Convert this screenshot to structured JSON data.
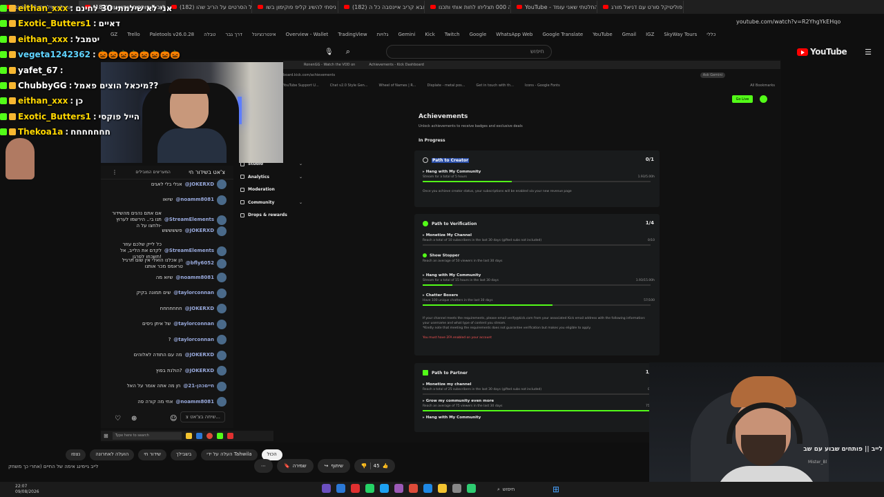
{
  "browser": {
    "tabs": [
      {
        "label": "אני לא שילמתי 30 לחינם",
        "active": false
      },
      {
        "label": "(182) לייב || פותחים שבוע עם",
        "active": true
      },
      {
        "label": "(182) כל הסרטים על הריב שהו",
        "active": false
      },
      {
        "label": "ניסתי להשיג קליפ פוקימון בשו",
        "active": false
      },
      {
        "label": "(182) אבא קריב איינסבה כל ה",
        "active": false
      },
      {
        "label": "מה 000 תצליחו לחות אותי ותכנו",
        "active": false
      },
      {
        "label": "YouTube - החלטתי שאני עומד",
        "active": false
      },
      {
        "label": "פוליטיקל סורט עם דניאל מורג",
        "active": false
      }
    ],
    "url": "youtube.com/watch?v=R2YhgYkEHqo",
    "bookmarks": [
      "GZ",
      "Trello",
      "Paletools v26.0.28",
      "טבלה",
      "דרך גבר",
      "אינטרנציונל",
      "Overview - Wallet",
      "TradingView",
      "גלויות",
      "Gemini",
      "Kick",
      "Twitch",
      "Google",
      "WhatsApp Web",
      "Google Translate",
      "YouTube",
      "Gmail",
      "IGZ",
      "SkyWay Tours",
      "כללי"
    ]
  },
  "youtube": {
    "search_placeholder": "חיפוש",
    "logo_text": "YouTube",
    "video_title": "לייב || פותחים שבוע עם שב",
    "channel": "Mister_Bl",
    "chips": [
      {
        "label": "הכול",
        "active": true
      },
      {
        "label": "העלה על ידי Tahwila",
        "active": false
      },
      {
        "label": "בשבילך",
        "active": false
      },
      {
        "label": "שידור חי",
        "active": false
      },
      {
        "label": "הועלה לאחרונה",
        "active": false
      },
      {
        "label": "נצפו",
        "active": false
      }
    ],
    "actions": {
      "like_count": "45",
      "share": "שיתוף",
      "save": "שמירה",
      "more": "⋯"
    },
    "bottom_left": "לייב גיימינג אימה של החיים (אחרי כך משחק"
  },
  "overlay_chat": [
    {
      "user": "eithan_xxx",
      "msg": "אני לא שילמתי 30 לחינם",
      "color": "#ffd700"
    },
    {
      "user": "Exotic_Butters1",
      "msg": "דאיים",
      "color": "#ffd700"
    },
    {
      "user": "eithan_xxx",
      "msg": "יטמבל",
      "color": "#ffd700"
    },
    {
      "user": "vegeta1242362",
      "msg": "🎃🎃🎃🎃🎃🎃🎃🎃",
      "color": "#5fd3ff"
    },
    {
      "user": "yafet_67",
      "msg": "",
      "color": "#ffffff"
    },
    {
      "user": "ChubbyGG",
      "msg": "מיכאל הוצים פאמל??",
      "color": "#ffffff"
    },
    {
      "user": "eithan_xxx",
      "msg": "כן",
      "color": "#ffd700"
    },
    {
      "user": "Exotic_Butters1",
      "msg": "הייל פוקסי",
      "color": "#ffd700"
    },
    {
      "user": "Thekoa1a",
      "msg": "חחחחחחח",
      "color": "#ffd700"
    }
  ],
  "inner_browser": {
    "tabs": [
      "RonenGG - Watch the VOD on",
      "Achievements - Kick Dashboard"
    ],
    "url": "board.kick.com/achievements",
    "bookmarks": [
      "YouTube Support U...",
      "Chat v2.0 Style Gen...",
      "Wheel of Names | R...",
      "Displate - metal pos...",
      "Get in touch with th...",
      "Icons - Google Fonts"
    ],
    "ask_gemini": "Ask Gemini",
    "go_live": "Go Live",
    "all_bookmarks": "All Bookmarks"
  },
  "kick_chat": {
    "header_title": "צ'אט בשידור חי",
    "header_right": "המעריצים המובילים",
    "input_placeholder": "שיחה בצ'אט צ...",
    "messages": [
      {
        "user": "@JOKERXD",
        "text": "אנלי בלי לאגים"
      },
      {
        "user": "@noamm8081",
        "text": "שיואו"
      },
      {
        "user": "@StreamElements",
        "text": "אם אתם נהנים מהשידור תנו בי.. הירשמו לערוץ ולחצו על ה-"
      },
      {
        "user": "@JOKERXD",
        "text": "פששששש"
      },
      {
        "user": "@StreamElements",
        "text": "כל לייק שלכם עוזר לקדם את הלייב, אל תשכחו לפרגן!"
      },
      {
        "user": "@bfly6052",
        "text": "הן אכלנו הואלי אין שום תרגיל טראמפ מכר אותנו"
      },
      {
        "user": "@noamm8081",
        "text": "שיוא מה"
      },
      {
        "user": "@taylorconnan",
        "text": "שים תמונה בקיק"
      },
      {
        "user": "@JOKERXD",
        "text": "חחחחחחח"
      },
      {
        "user": "@taylorconnan",
        "text": "של איתן ניסים"
      },
      {
        "user": "@taylorconnan",
        "text": "?"
      },
      {
        "user": "@JOKERXD",
        "text": "מה עם התודה לאלוהים"
      },
      {
        "user": "@JOKERXD",
        "text": "הולנת בפוץ?"
      },
      {
        "user": "@חייםכהן-21",
        "text": "חן מה אתה אומר על האל"
      },
      {
        "user": "@noamm8081",
        "text": "אחי מה קורה פה"
      }
    ]
  },
  "kick_nav": [
    {
      "label": "Studio",
      "chevron": true
    },
    {
      "label": "Analytics",
      "chevron": true
    },
    {
      "label": "Moderation",
      "chevron": false
    },
    {
      "label": "Community",
      "chevron": true
    },
    {
      "label": "Drops & rewards",
      "chevron": false
    }
  ],
  "achievements": {
    "title": "Achievements",
    "subtitle": "Unlock achievements to receive badges and exclusive deals",
    "section": "In Progress",
    "cards": [
      {
        "title": "Path to Creator",
        "count": "0/1",
        "items": [
          {
            "name": "Hang with My Community",
            "desc": "Stream for a total of 5 hours",
            "value": "1.93/5.00h",
            "progress": 0.39,
            "done": false
          }
        ],
        "notes": [
          "Once you achieve creator status, your subscriptions will be enabled via your new revenue page"
        ]
      },
      {
        "title": "Path to Verification",
        "count": "1/4",
        "items": [
          {
            "name": "Monetize My Channel",
            "desc": "Reach a total of 10 subscribers in the last 30 days (gifted subs not included)",
            "value": "0/10",
            "progress": 0,
            "done": false
          },
          {
            "name": "Show Stopper",
            "desc": "Reach an average of 50 viewers in the last 30 days",
            "value": "",
            "progress": null,
            "done": true
          },
          {
            "name": "Hang with My Community",
            "desc": "Stream for a total of 15 hours in the last 30 days",
            "value": "1.93/15.00h",
            "progress": 0.13,
            "done": false
          },
          {
            "name": "Chatter Boxers",
            "desc": "Have 100 unique chatters in the last 30 days",
            "value": "57/100",
            "progress": 0.57,
            "done": false
          }
        ],
        "notes": [
          "If your channel meets the requirements, please email verify@kick.com from your associated Kick email address with the following information: your username and what type of content you stream.",
          "*Kindly note that meeting the requirements does not guarantee verification but makes you eligible to apply.",
          "You must have 2FA enabled on your account"
        ]
      },
      {
        "title": "Path to Partner",
        "count": "1/5",
        "items": [
          {
            "name": "Monetize my channel",
            "desc": "Reach a total of 25 subscribers in the last 30 days (gifted subs not included)",
            "value": "0/25",
            "progress": 0,
            "done": false
          },
          {
            "name": "Grow my community even more",
            "desc": "Reach an average of 75 viewers in the last 30 days",
            "value": "75/75",
            "progress": 1.0,
            "done": false
          },
          {
            "name": "Hang with My Community",
            "desc": "",
            "value": "",
            "progress": null,
            "done": false
          }
        ],
        "notes": []
      }
    ]
  },
  "taskbar": {
    "time": "22:07",
    "date": "09/08/2026",
    "search": "חיפוש",
    "inner_search": "Type here to search"
  },
  "colors": {
    "kick_green": "#53fc18",
    "youtube_red": "#ff0000"
  }
}
